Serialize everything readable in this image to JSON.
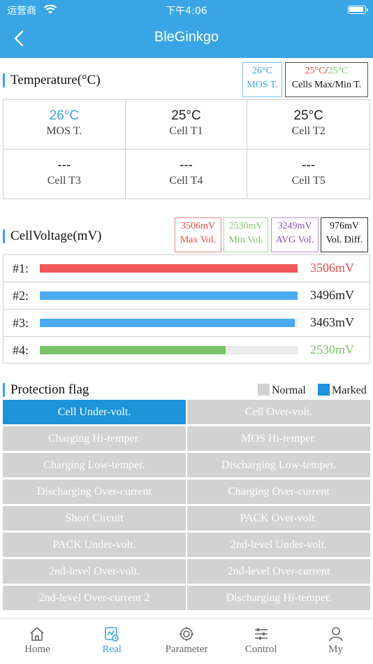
{
  "status_bar": {
    "carrier": "运营商",
    "time": "下午4:06"
  },
  "nav": {
    "title": "BleGinkgo"
  },
  "temperature": {
    "title": "Temperature(°C)",
    "legend_mos": {
      "value": "26°C",
      "label": "MOS T."
    },
    "legend_cells": {
      "max": "25°C",
      "sep": "/",
      "min": "25°C",
      "label": "Cells Max/Min T."
    },
    "cells": [
      {
        "value": "26°C",
        "label": "MOS T.",
        "highlight": true
      },
      {
        "value": "25°C",
        "label": "Cell T1",
        "highlight": false
      },
      {
        "value": "25°C",
        "label": "Cell T2",
        "highlight": false
      },
      {
        "value": "---",
        "label": "Cell T3",
        "highlight": false
      },
      {
        "value": "---",
        "label": "Cell T4",
        "highlight": false
      },
      {
        "value": "---",
        "label": "Cell T5",
        "highlight": false
      }
    ]
  },
  "cell_voltage": {
    "title": "CellVoltage(mV)",
    "legend": [
      {
        "value": "3506mV",
        "label": "Max Vol.",
        "color": "#e84a4a",
        "border": "#e88a8a"
      },
      {
        "value": "2530mV",
        "label": "Min Vol.",
        "color": "#7cc46a",
        "border": "#a6d89a"
      },
      {
        "value": "3249mV",
        "label": "AVG Vol.",
        "color": "#8a4fbf",
        "border": "#b48fd6"
      },
      {
        "value": "976mV",
        "label": "Vol. Diff.",
        "color": "#111111",
        "border": "#333333"
      }
    ],
    "rows": [
      {
        "label": "#1:",
        "value": "3506mV",
        "fill": 1.0,
        "bar_color": "#f15858",
        "text_color": "#e84a4a"
      },
      {
        "label": "#2:",
        "value": "3496mV",
        "fill": 1.0,
        "bar_color": "#4aaaf0",
        "text_color": "#222222"
      },
      {
        "label": "#3:",
        "value": "3463mV",
        "fill": 0.99,
        "bar_color": "#4aaaf0",
        "text_color": "#222222"
      },
      {
        "label": "#4:",
        "value": "2530mV",
        "fill": 0.722,
        "bar_color": "#7cc46a",
        "text_color": "#7cc46a"
      }
    ]
  },
  "protection": {
    "title": "Protection flag",
    "legend_normal": "Normal",
    "legend_marked": "Marked",
    "colors": {
      "normal": "#d2d2d2",
      "marked": "#1d93d8"
    },
    "flags": [
      {
        "label": "Cell Under-volt.",
        "marked": true
      },
      {
        "label": "Cell Over-volt.",
        "marked": false
      },
      {
        "label": "Charging Hi-temper.",
        "marked": false
      },
      {
        "label": "MOS Hi-temper.",
        "marked": false
      },
      {
        "label": "Charging Low-temper.",
        "marked": false
      },
      {
        "label": "Discharging Low-temper.",
        "marked": false
      },
      {
        "label": "Discharging Over-current",
        "marked": false
      },
      {
        "label": "Charging Over-current",
        "marked": false
      },
      {
        "label": "Short Circuit",
        "marked": false
      },
      {
        "label": "PACK Over-volt.",
        "marked": false
      },
      {
        "label": "PACK Under-volt.",
        "marked": false
      },
      {
        "label": "2nd-level Under-volt.",
        "marked": false
      },
      {
        "label": "2nd-level Over-volt.",
        "marked": false
      },
      {
        "label": "2nd-level Over-current",
        "marked": false
      },
      {
        "label": "2nd-level Over-current 2",
        "marked": false
      },
      {
        "label": "Discharging Hi-temper.",
        "marked": false
      }
    ]
  },
  "tabbar": {
    "active": 1,
    "tabs": [
      {
        "label": "Home",
        "icon": "home-icon"
      },
      {
        "label": "Real",
        "icon": "realtime-icon"
      },
      {
        "label": "Parameter",
        "icon": "gear-icon"
      },
      {
        "label": "Control",
        "icon": "sliders-icon"
      },
      {
        "label": "My",
        "icon": "user-icon"
      }
    ]
  }
}
